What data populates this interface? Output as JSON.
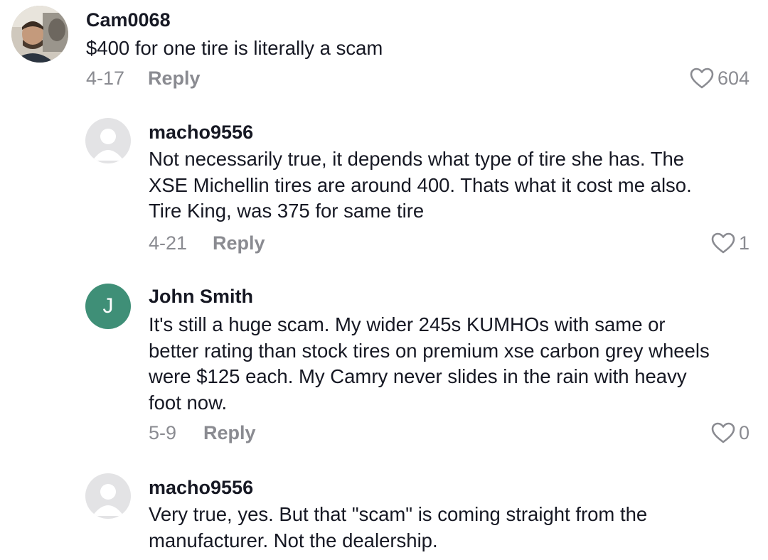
{
  "comments": [
    {
      "username": "Cam0068",
      "avatar_icon": "user-photo",
      "text": [
        "$400 for one tire is literally a scam"
      ],
      "date": "4-17",
      "reply_label": "Reply",
      "likes": "604"
    },
    {
      "username": "macho9556",
      "avatar_icon": "default-user-icon",
      "text": [
        "Not necessarily true, it depends what type of tire she has. The",
        "XSE Michellin tires are around 400. Thats what it cost me also.",
        "Tire King, was 375 for same tire"
      ],
      "date": "4-21",
      "reply_label": "Reply",
      "likes": "1"
    },
    {
      "username": "John Smith",
      "avatar_letter": "J",
      "text": [
        "It's still a huge scam. My wider 245s KUMHOs with same or",
        "better rating than stock tires on premium xse carbon grey wheels",
        "were $125 each. My Camry never slides in the rain with heavy",
        "foot now."
      ],
      "date": "5-9",
      "reply_label": "Reply",
      "likes": "0"
    },
    {
      "username": "macho9556",
      "avatar_icon": "default-user-icon",
      "text": [
        "Very true, yes. But that \"scam\" is coming straight from the",
        "manufacturer. Not the dealership."
      ]
    }
  ],
  "colors": {
    "text": "#161823",
    "muted": "#8a8b91",
    "avatar_default_bg": "#e3e3e5",
    "avatar_letter_bg": "#3f8f77"
  }
}
